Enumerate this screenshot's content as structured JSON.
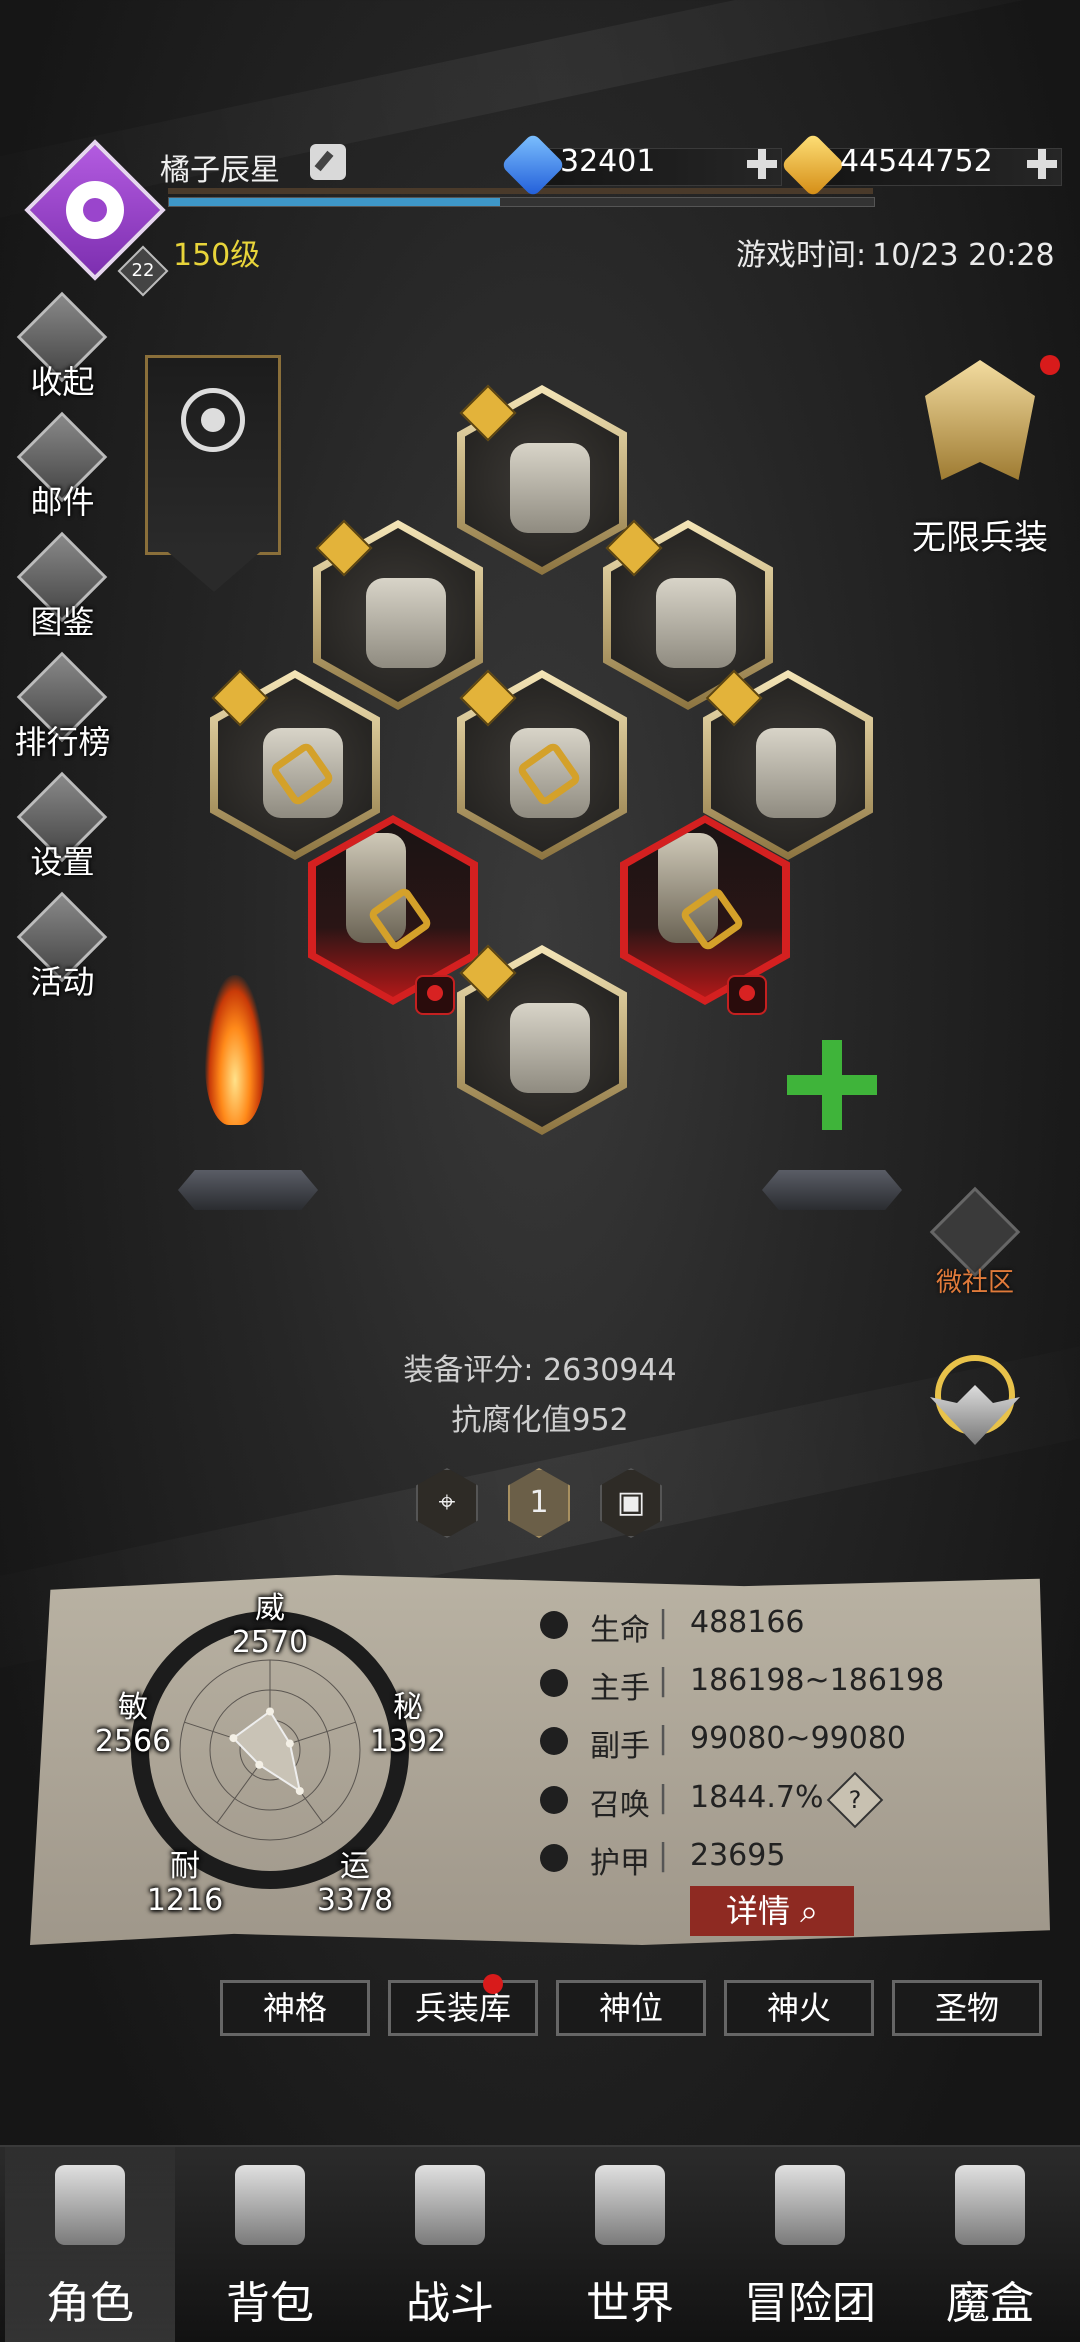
{
  "player": {
    "name": "橘子辰星",
    "level": "150级",
    "badge": "22",
    "xp_fraction": 0.47
  },
  "game_time": {
    "label": "游戏时间:",
    "value": "10/23 20:28"
  },
  "currency": {
    "diamonds": "32401",
    "gold": "44544752"
  },
  "side_menu": [
    {
      "label": "收起",
      "icon": "collapse-icon"
    },
    {
      "label": "邮件",
      "icon": "mail-icon"
    },
    {
      "label": "图鉴",
      "icon": "book-icon"
    },
    {
      "label": "排行榜",
      "icon": "ranking-icon"
    },
    {
      "label": "设置",
      "icon": "settings-icon"
    },
    {
      "label": "活动",
      "icon": "event-icon"
    }
  ],
  "infinite_gear": {
    "label": "无限兵装"
  },
  "community": {
    "label": "微社区"
  },
  "equipment": {
    "score_label": "装备评分:",
    "score": "2630944",
    "anti_corruption": "抗腐化值952"
  },
  "loadout_tabs": {
    "active": "1"
  },
  "radar": {
    "stats": [
      {
        "name": "威",
        "value": "2570"
      },
      {
        "name": "秘",
        "value": "1392"
      },
      {
        "name": "运",
        "value": "3378"
      },
      {
        "name": "耐",
        "value": "1216"
      },
      {
        "name": "敏",
        "value": "2566"
      }
    ]
  },
  "stats": [
    {
      "name": "生命",
      "value": "488166",
      "icon": "heart-icon"
    },
    {
      "name": "主手",
      "value": "186198~186198",
      "icon": "main-hand-icon"
    },
    {
      "name": "副手",
      "value": "99080~99080",
      "icon": "off-hand-icon"
    },
    {
      "name": "召唤",
      "value": "1844.7%",
      "icon": "summon-icon"
    },
    {
      "name": "护甲",
      "value": "23695",
      "icon": "armor-icon"
    }
  ],
  "detail_button": "详情",
  "sub_buttons": [
    "神格",
    "兵装库",
    "神位",
    "神火",
    "圣物"
  ],
  "bottom_nav": [
    {
      "label": "角色",
      "icon": "helmet-icon",
      "active": true
    },
    {
      "label": "背包",
      "icon": "backpack-icon"
    },
    {
      "label": "战斗",
      "icon": "sword-shield-icon"
    },
    {
      "label": "世界",
      "icon": "map-icon"
    },
    {
      "label": "冒险团",
      "icon": "castle-icon"
    },
    {
      "label": "魔盒",
      "icon": "cube-icon"
    }
  ],
  "colors": {
    "accent_gold": "#e8d43a",
    "alert_red": "#d81b1b",
    "xp_blue": "#3e97c8"
  }
}
